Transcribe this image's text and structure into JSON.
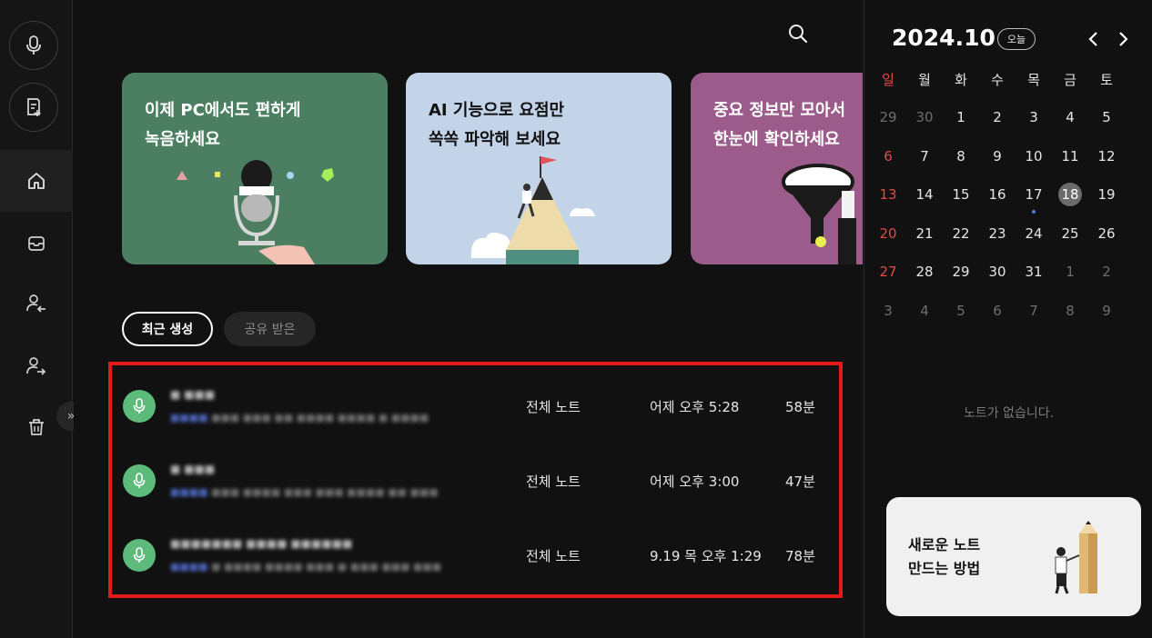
{
  "rail": {
    "items": [
      {
        "name": "record",
        "icon": "microphone-icon"
      },
      {
        "name": "new-note",
        "icon": "note-add-icon"
      },
      {
        "name": "home",
        "icon": "home-icon",
        "active": true
      },
      {
        "name": "inbox",
        "icon": "inbox-icon"
      },
      {
        "name": "received",
        "icon": "user-arrow-in-icon"
      },
      {
        "name": "shared",
        "icon": "user-arrow-out-icon"
      },
      {
        "name": "trash",
        "icon": "trash-icon"
      }
    ],
    "expand_label": "»"
  },
  "banners": [
    {
      "line1": "이제 PC에서도 편하게",
      "line2": "녹음하세요",
      "color": "#4c7f62"
    },
    {
      "line1": "AI 기능으로 요점만",
      "line2": "쏙쏙 파악해 보세요",
      "color": "#c4d4e8"
    },
    {
      "line1": "중요 정보만 모아서",
      "line2": "한눈에 확인하세요",
      "color": "#9b5c8b"
    }
  ],
  "tabs": {
    "recent": "최근 생성",
    "shared": "공유 받은"
  },
  "notes": [
    {
      "title": "■ ■■■",
      "preview_lead": "■■■■",
      "preview": "■■■ ■■■ ■■ ■■■■ ■■■■ ■ ■■■■",
      "folder": "전체 노트",
      "when": "어제 오후 5:28",
      "duration": "58분"
    },
    {
      "title": "■ ■■■",
      "preview_lead": "■■■■",
      "preview": "■■■ ■■■■ ■■■ ■■■ ■■■■ ■■ ■■■",
      "folder": "전체 노트",
      "when": "어제 오후 3:00",
      "duration": "47분"
    },
    {
      "title": "■■■■■■■ ■■■■ ■■■■■■",
      "preview_lead": "■■■■",
      "preview": "■ ■■■■ ■■■■ ■■■ ■ ■■■ ■■■ ■■■",
      "folder": "전체 노트",
      "when": "9.19 목 오후 1:29",
      "duration": "78분"
    }
  ],
  "calendar": {
    "month_label": "2024.10",
    "today_label": "오늘",
    "weekdays": [
      "일",
      "월",
      "화",
      "수",
      "목",
      "금",
      "토"
    ],
    "weeks": [
      [
        "29",
        "30",
        "1",
        "2",
        "3",
        "4",
        "5"
      ],
      [
        "6",
        "7",
        "8",
        "9",
        "10",
        "11",
        "12"
      ],
      [
        "13",
        "14",
        "15",
        "16",
        "17",
        "18",
        "19"
      ],
      [
        "20",
        "21",
        "22",
        "23",
        "24",
        "25",
        "26"
      ],
      [
        "27",
        "28",
        "29",
        "30",
        "31",
        "1",
        "2"
      ],
      [
        "3",
        "4",
        "5",
        "6",
        "7",
        "8",
        "9"
      ]
    ],
    "today": "18",
    "dot_day": "17",
    "empty_text": "노트가 없습니다."
  },
  "howto": {
    "line1": "새로운 노트",
    "line2": "만드는 방법"
  },
  "colors": {
    "accent_green": "#5cba7b",
    "highlight_box": "#e31b1b",
    "sunday_red": "#e24a4a",
    "event_dot": "#4d7fd8"
  }
}
